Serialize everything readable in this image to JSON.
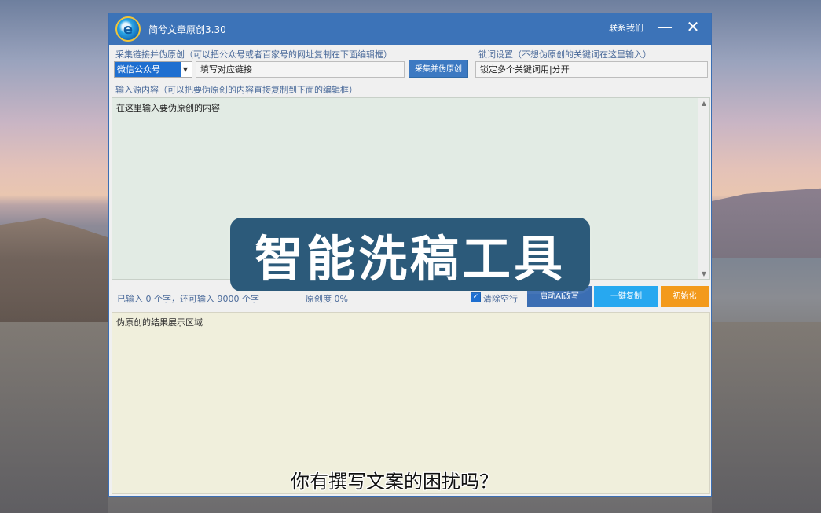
{
  "window": {
    "title": "简兮文章原创3.30",
    "contact": "联系我们",
    "minimize_glyph": "—",
    "close_glyph": "✕",
    "logo_glyph": "e"
  },
  "collect": {
    "label": "采集链接并伪原创（可以把公众号或者百家号的网址复制在下面编辑框）",
    "source_selected": "微信公众号",
    "url_value": "填写对应链接",
    "button": "采集并伪原创"
  },
  "lock": {
    "label": "锁词设置（不想伪原创的关键词在这里输入）",
    "value": "锁定多个关键词用|分开"
  },
  "input": {
    "label": "输入源内容（可以把要伪原创的内容直接复制到下面的编辑框）",
    "placeholder": "在这里输入要伪原创的内容"
  },
  "status": {
    "count_text": "已输入 0 个字，还可输入 9000 个字",
    "originality_text": "原创度 0%",
    "clear_blank_label": "清除空行",
    "clear_blank_checked": true
  },
  "buttons": {
    "ai": "启动AI改写",
    "copy": "一键复制",
    "init": "初始化"
  },
  "result": {
    "placeholder": "伪原创的结果展示区域"
  },
  "overlay": {
    "banner": "智能洗稿工具",
    "subtitle": "你有撰写文案的困扰吗？"
  },
  "colors": {
    "titlebar": "#3c73b8",
    "copy_button": "#27a8f0",
    "init_button": "#f39a1c",
    "banner_bg": "#2c5a7a"
  }
}
